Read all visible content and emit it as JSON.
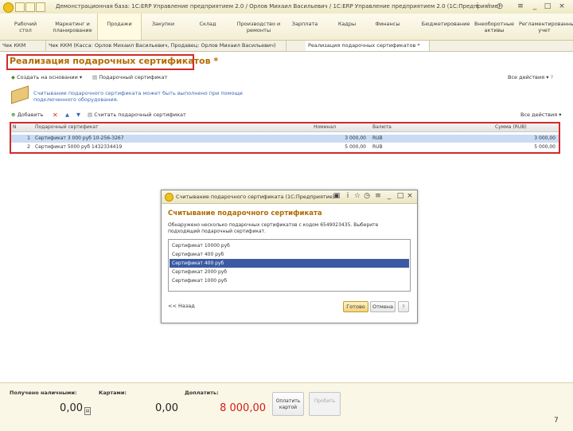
{
  "window": {
    "title": "Демонстрационная база: 1С:ERP Управление предприятием 2.0 / Орлов Михаил Васильевич / 1С:ERP Управление предприятием 2.0 (1С:Предприятие)"
  },
  "sections": [
    {
      "label": "Рабочий стол"
    },
    {
      "label": "Маркетинг и планирование"
    },
    {
      "label": "Продажи"
    },
    {
      "label": "Закупки"
    },
    {
      "label": "Склад"
    },
    {
      "label": "Производство и ремонты"
    },
    {
      "label": "Зарплата"
    },
    {
      "label": "Кадры"
    },
    {
      "label": "Финансы"
    },
    {
      "label": "Бюджетирование"
    },
    {
      "label": "Внеоборотные активы"
    },
    {
      "label": "Регламентированный учет"
    }
  ],
  "tabs": [
    {
      "label": "Чек ККМ"
    },
    {
      "label": "Чек ККМ (Касса: Орлов Михаил Васильевич, Продавец: Орлов Михаил Васильевич)"
    },
    {
      "label": "Реализация подарочных сертификатов *"
    }
  ],
  "form": {
    "title": "Реализация подарочных сертификатов *",
    "toolbar": {
      "create_based_on": "Создать на основании",
      "gift_certificate": "Подарочный сертификат",
      "all_actions": "Все действия"
    },
    "hint": "Считывание подарочного сертификата может быть выполнено при помощи подключенного оборудования.",
    "table_toolbar": {
      "add": "Добавить",
      "read_certificate": "Считать подарочный сертификат",
      "all_actions": "Все действия"
    },
    "table": {
      "columns": [
        "N",
        "Подарочный сертификат",
        "Номинал",
        "Валюта",
        "Сумма (RUB)"
      ],
      "rows": [
        {
          "n": "1",
          "certificate": "Сертификат 3 000 руб 10-256-3267",
          "nominal": "3 000,00",
          "currency": "RUB",
          "amount": "3 000,00"
        },
        {
          "n": "2",
          "certificate": "Сертификат 5000 руб 1432334419",
          "nominal": "5 000,00",
          "currency": "RUB",
          "amount": "5 000,00"
        }
      ]
    }
  },
  "dialog": {
    "title": "Считывание подарочного сертификата (1С:Предприятие)",
    "heading": "Считывание подарочного сертификата",
    "description": "Обнаружено несколько подарочных сертификатов с кодом 6549023435. Выберите подходящий подарочный сертификат.",
    "items": [
      {
        "label": "Сертификат 10000 руб"
      },
      {
        "label": "Сертификат 400 руб"
      },
      {
        "label": "Сертификат 400 руб"
      },
      {
        "label": "Сертификат 2000 руб"
      },
      {
        "label": "Сертификат 1000 руб"
      }
    ],
    "selected_index": 2,
    "back": "<< Назад",
    "done": "Готово",
    "cancel": "Отмена"
  },
  "bottom": {
    "cash_label": "Получено наличными:",
    "cash_value": "0,00",
    "cards_label": "Картами:",
    "cards_value": "0,00",
    "topay_label": "Доплатить:",
    "topay_value": "8 000,00",
    "pay_card_button": "Оплатить картой",
    "sell_button": "Пробить"
  },
  "page_number": "7",
  "colors": {
    "highlight_red": "#d22a2a",
    "title_orange": "#b36b00",
    "selected_row": "#3b5aa3",
    "amount_red": "#d21b1b"
  }
}
